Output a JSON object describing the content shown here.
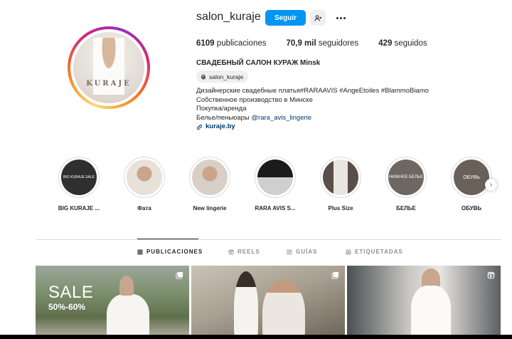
{
  "profile": {
    "username": "salon_kuraje",
    "follow_label": "Seguir",
    "avatar_text": "KURAJE",
    "full_name": "СВАДЕБНЫЙ САЛОН КУРАЖ Minsk",
    "threads_handle": "salon_kuraje",
    "stats": {
      "posts_count": "6109",
      "posts_label": "publicaciones",
      "followers_count": "70,9 mil",
      "followers_label": "seguidores",
      "following_count": "429",
      "following_label": "seguidos"
    },
    "bio": {
      "line1": "Дизайнерские свадебные платья#RARAAVIS #AngeEtoiles #BlammoBiamo",
      "line2": "Собственное производство в Минске",
      "line3": "Покупка/аренда",
      "line4_prefix": "Белье/пеньюары ",
      "line4_mention": "@rara_avis_lingerie",
      "link": "kuraje.by"
    }
  },
  "highlights": [
    {
      "label": "BIG KURAJE ...",
      "cover_text": "BIG KURAJE SALE"
    },
    {
      "label": "Фата"
    },
    {
      "label": "New lingerie"
    },
    {
      "label": "RARA AVIS S..."
    },
    {
      "label": "Plus Size"
    },
    {
      "label": "БЕЛЬЕ",
      "cover_text": "НИЖНЕЕ БЕЛЬЕ"
    },
    {
      "label": "ОБУВЬ",
      "cover_text": "ОБУВЬ"
    }
  ],
  "tabs": {
    "posts": "PUBLICACIONES",
    "reels": "REELS",
    "guides": "GUÍAS",
    "tagged": "ETIQUETADAS"
  },
  "posts": [
    {
      "title": "SALE",
      "subtitle": "50%-60%"
    },
    {},
    {}
  ],
  "colors": {
    "accent": "#0095f6",
    "link": "#00376b",
    "text": "#262626",
    "muted": "#8e8e8e"
  }
}
